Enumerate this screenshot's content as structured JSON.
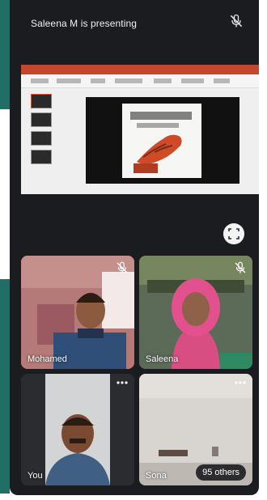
{
  "presentation": {
    "title": "Saleena M is presenting"
  },
  "participants": [
    {
      "name": "Mohamed"
    },
    {
      "name": "Saleena"
    },
    {
      "name": "You"
    },
    {
      "name": "Sona"
    }
  ],
  "others_badge": "95 others",
  "icons": {
    "header_mic": "mic-off-icon",
    "fullscreen": "fullscreen-icon",
    "tile_mic": "mic-off-icon",
    "more": "more-options-icon"
  }
}
